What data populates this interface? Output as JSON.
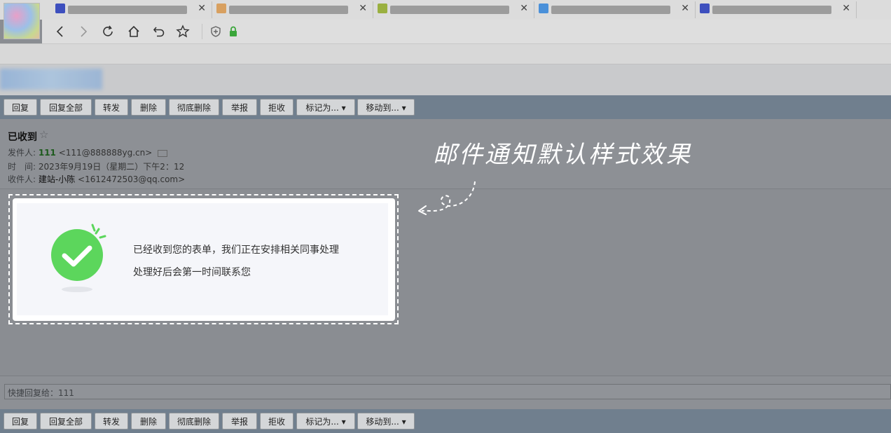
{
  "browser": {
    "tabs": [
      {
        "favicon_color": "#3d4fbe"
      },
      {
        "favicon_color": "#d8a060"
      },
      {
        "favicon_color": "#9ab040"
      },
      {
        "favicon_color": "#4a90d9"
      },
      {
        "favicon_color": "#3d4fbe"
      }
    ],
    "close_glyph": "✕",
    "nav_icons": [
      "back-icon",
      "forward-icon",
      "reload-icon",
      "home-icon",
      "undo-icon",
      "bookmark-star-icon",
      "shield-icon",
      "lock-icon"
    ]
  },
  "toolbar": {
    "reply": "回复",
    "reply_all": "回复全部",
    "forward": "转发",
    "delete": "删除",
    "delete_forever": "彻底删除",
    "report": "举报",
    "reject": "拒收",
    "mark_as": "标记为... ▾",
    "move_to": "移动到... ▾"
  },
  "mail": {
    "subject": "已收到",
    "star": "☆",
    "sender_label": "发件人: ",
    "sender_name": "111",
    "sender_email": " <111@888888yg.cn>",
    "time_label": "时　间: ",
    "time_value": "2023年9月19日（星期二）下午2：12",
    "recipient_label": "收件人: ",
    "recipient_name": "建站-小陈",
    "recipient_email": " <1612472503@qq.com>"
  },
  "body": {
    "line1": "已经收到您的表单，我们正在安排相关同事处理",
    "line2": "处理好后会第一时间联系您",
    "check_color": "#5cd65c"
  },
  "annotation": {
    "text": "邮件通知默认样式效果"
  },
  "quick_reply": {
    "text": "快捷回复给：111"
  }
}
